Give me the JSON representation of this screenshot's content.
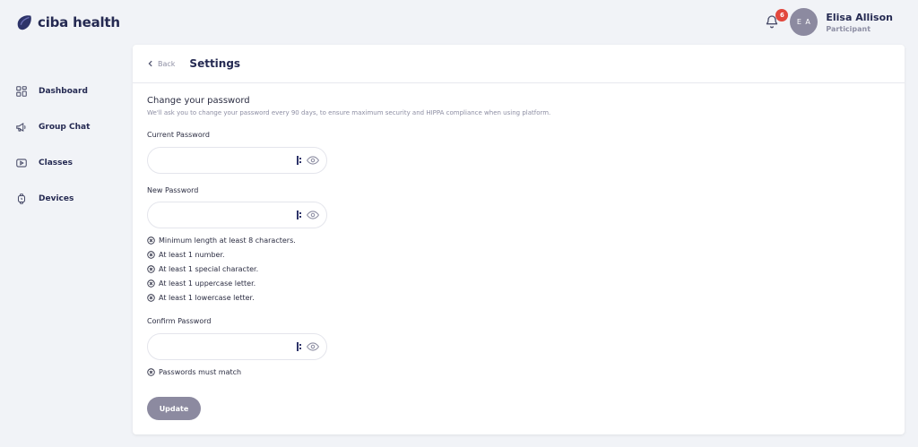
{
  "brand": {
    "name": "ciba health",
    "color": "#252a52",
    "logo_icon": "ciba-logo-icon"
  },
  "header": {
    "notification_count": "6",
    "avatar_initials": "E A",
    "user_name": "Elisa Allison",
    "user_role": "Participant"
  },
  "sidebar": {
    "items": [
      {
        "label": "Dashboard",
        "icon": "dashboard-icon"
      },
      {
        "label": "Group Chat",
        "icon": "megaphone-icon"
      },
      {
        "label": "Classes",
        "icon": "video-icon"
      },
      {
        "label": "Devices",
        "icon": "watch-icon"
      }
    ]
  },
  "page": {
    "back_label": "Back",
    "title": "Settings",
    "section_title": "Change your password",
    "section_desc": "We'll ask you to change your password every 90 days, to ensure maximum security and HIPPA compliance when using platform."
  },
  "form": {
    "current_label": "Current Password",
    "current_value": "",
    "new_label": "New Password",
    "new_value": "",
    "confirm_label": "Confirm Password",
    "confirm_value": "",
    "rules": [
      "Minimum length at least 8 characters.",
      "At least 1 number.",
      "At least 1 special character.",
      "At least 1 uppercase letter.",
      "At least 1 lowercase letter."
    ],
    "match_rule": "Passwords must match",
    "update_label": "Update"
  },
  "colors": {
    "accent_button": "#8c8aa0",
    "badge": "#e2473d",
    "muted_text": "#8d8ea3"
  }
}
